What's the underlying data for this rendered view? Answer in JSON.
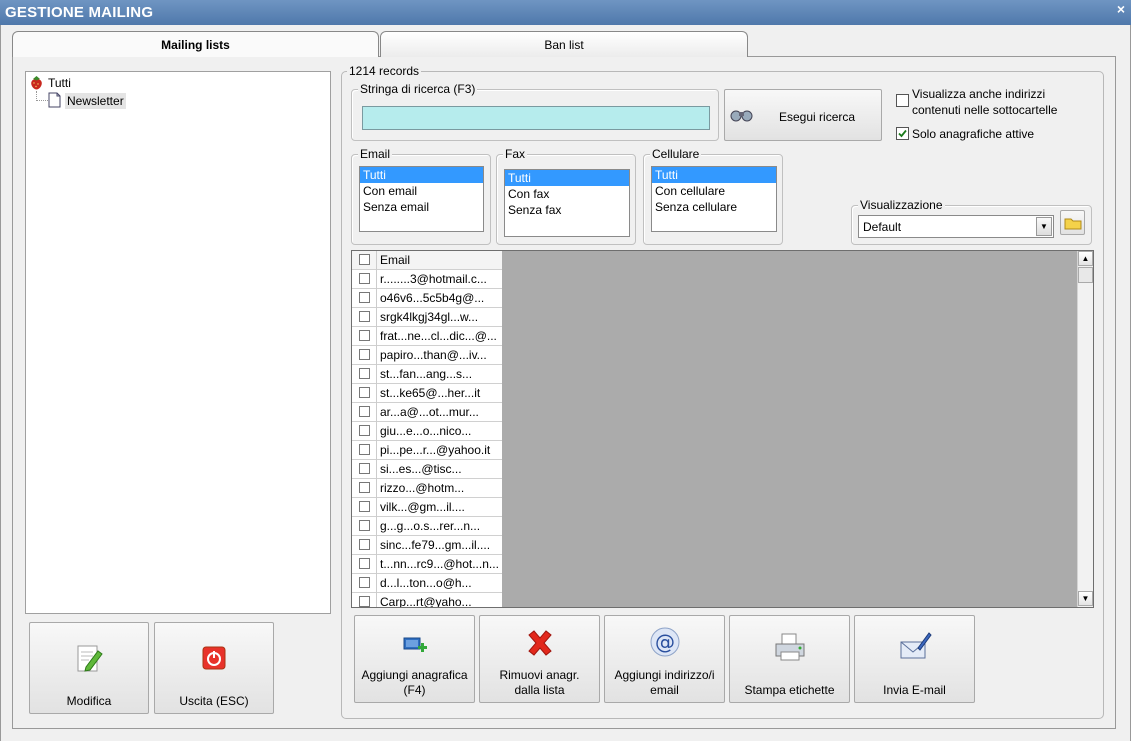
{
  "window": {
    "title": "GESTIONE MAILING",
    "close": "×"
  },
  "tabs": [
    {
      "label": "Mailing lists"
    },
    {
      "label": "Ban list"
    }
  ],
  "tree": {
    "root": "Tutti",
    "child": "Newsletter"
  },
  "left_buttons": {
    "modify": "Modifica",
    "exit": "Uscita (ESC)"
  },
  "records": "1214 records",
  "search": {
    "legend": "Stringa di ricerca (F3)",
    "value": "",
    "button": "Esegui ricerca"
  },
  "options": {
    "subfolders": "Visualizza anche indirizzi contenuti nelle sottocartelle",
    "subfolders_checked": false,
    "active_only": "Solo anagrafiche attive",
    "active_only_checked": true
  },
  "filters": {
    "email": {
      "legend": "Email",
      "items": [
        "Tutti",
        "Con email",
        "Senza email"
      ],
      "selected": 0
    },
    "fax": {
      "legend": "Fax",
      "items": [
        "Tutti",
        "Con fax",
        "Senza fax"
      ],
      "selected": 0
    },
    "cellulare": {
      "legend": "Cellulare",
      "items": [
        "Tutti",
        "Con cellulare",
        "Senza cellulare"
      ],
      "selected": 0
    }
  },
  "view": {
    "legend": "Visualizzazione",
    "selected": "Default"
  },
  "grid": {
    "header": "Email",
    "rows": [
      "r........3@hotmail.c...",
      "o46v6...5c5b4g@...",
      "srgk4lkgj34gl...w...",
      "frat...ne...cl...dic...@...",
      "papiro...than@...iv...",
      "st...fan...ang...s...",
      "st...ke65@...her...it",
      "ar...a@...ot...mur...",
      "giu...e...o...nico...",
      "pi...pe...r...@yahoo.it",
      "si...es...@tisc...",
      "rizzo...@hotm...",
      "vilk...@gm...il....",
      "g...g...o.s...rer...n...",
      "sinc...fe79...gm...il....",
      "t...nn...rc9...@hot...n...",
      "d...l...ton...o@h...",
      "Carp...rt@yaho..."
    ]
  },
  "action_buttons": [
    {
      "label": "Aggiungi anagrafica (F4)"
    },
    {
      "label": "Rimuovi anagr. dalla lista"
    },
    {
      "label": "Aggiungi indirizzo/i email"
    },
    {
      "label": "Stampa etichette"
    },
    {
      "label": "Invia E-mail"
    }
  ],
  "colors": {
    "titlebar": "#5a82b4",
    "search_bg": "#b6eced",
    "selection": "#3399ff",
    "grid_empty": "#ababab"
  }
}
